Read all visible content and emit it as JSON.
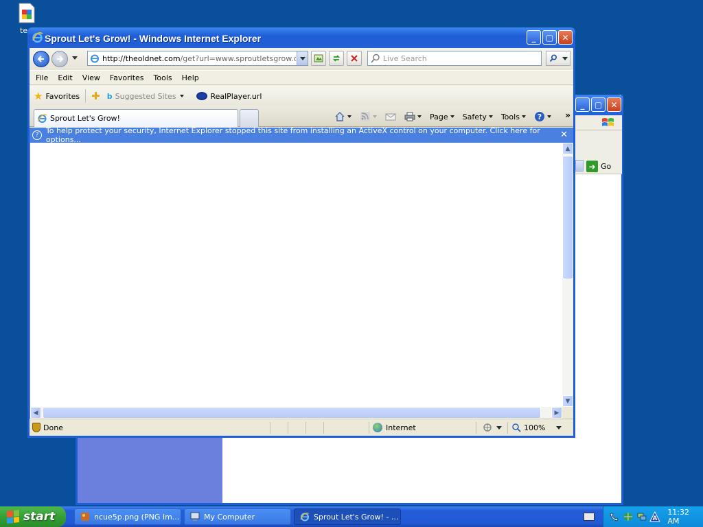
{
  "desktop": {
    "icon_label": "te"
  },
  "background_window": {
    "go_label": "Go"
  },
  "ie": {
    "title": "Sprout Let's Grow! - Windows Internet Explorer",
    "address_host": "http://theoldnet.com",
    "address_path": "/get?url=www.sproutletsgrow.com&y",
    "search_placeholder": "Live Search",
    "menu": [
      "File",
      "Edit",
      "View",
      "Favorites",
      "Tools",
      "Help"
    ],
    "favorites_label": "Favorites",
    "suggested_sites": "Suggested Sites",
    "realplayer": "RealPlayer.url",
    "tab_title": "Sprout Let's Grow!",
    "commands": {
      "page": "Page",
      "safety": "Safety",
      "tools": "Tools"
    },
    "more_chevron": "»",
    "info_bar": "To help protect your security, Internet Explorer stopped this site from installing an ActiveX control on your computer. Click here for options...",
    "status": {
      "done": "Done",
      "zone": "Internet",
      "zoom": "100%"
    }
  },
  "taskbar": {
    "start_label": "start",
    "tasks": [
      {
        "label": "ncue5p.png (PNG Im...",
        "active": false
      },
      {
        "label": "My Computer",
        "active": false
      },
      {
        "label": "Sprout Let's Grow! - ...",
        "active": true
      }
    ],
    "clock": "11:32 AM"
  },
  "colors": {
    "desktop": "#0a4f9a",
    "xp_blue": "#1c5fd6",
    "info_bar": "#4a81e0",
    "start_green": "#35a035",
    "tray": "#0f8ad9"
  }
}
